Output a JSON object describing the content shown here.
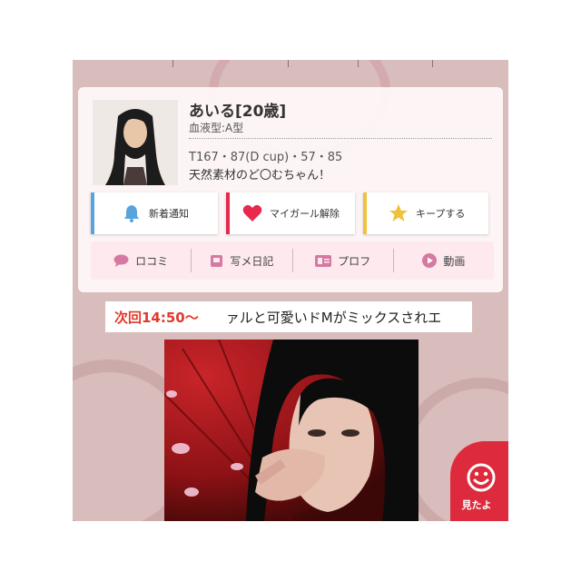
{
  "profile": {
    "name": "あいる[20歳]",
    "blood_type": "血液型:A型",
    "measurements": "T167・87(D cup)・57・85",
    "catchphrase": "天然素材のど〇むちゃん！"
  },
  "actions": [
    {
      "label": "新着通知",
      "icon": "bell-icon",
      "color": "#5aa4dd"
    },
    {
      "label": "マイガール解除",
      "icon": "heart-icon",
      "color": "#e6294d"
    },
    {
      "label": "キープする",
      "icon": "star-icon",
      "color": "#f0c13a"
    }
  ],
  "tabs": [
    {
      "label": "ロコミ",
      "icon": "speech-bubble-icon"
    },
    {
      "label": "写メ日記",
      "icon": "diary-icon"
    },
    {
      "label": "プロフ",
      "icon": "profile-card-icon"
    },
    {
      "label": "動画",
      "icon": "play-icon"
    }
  ],
  "next_shift": {
    "label": "次回14:50〜",
    "ticker": "ァルと可愛いドMがミックスされエ"
  },
  "seen_button": {
    "label": "見たよ",
    "icon": "smiley-icon"
  },
  "colors": {
    "background": "#d9bcbc",
    "accent_red": "#dd2a3c",
    "tab_bar": "#fde9ee"
  }
}
